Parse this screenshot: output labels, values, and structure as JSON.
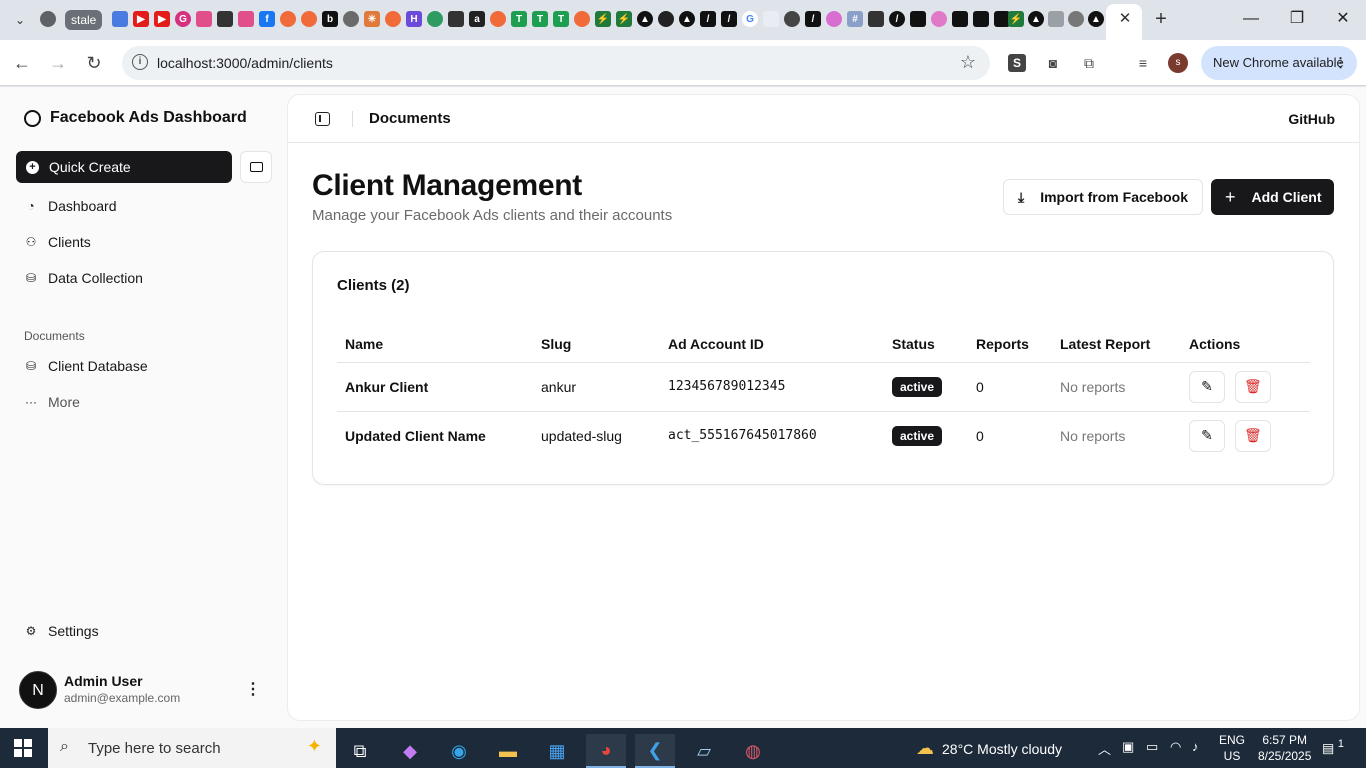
{
  "browser": {
    "stale_label": "stale",
    "url": "localhost:3000/admin/clients",
    "profile_initial": "s",
    "new_chrome_label": "New Chrome available"
  },
  "sidebar": {
    "brand": "Facebook Ads Dashboard",
    "quick_create": "Quick Create",
    "nav": [
      {
        "label": "Dashboard",
        "icon": "gauge-icon"
      },
      {
        "label": "Clients",
        "icon": "users-icon"
      },
      {
        "label": "Data Collection",
        "icon": "database-icon"
      }
    ],
    "documents_label": "Documents",
    "documents": [
      {
        "label": "Client Database",
        "icon": "database-icon"
      },
      {
        "label": "More",
        "icon": "ellipsis-icon"
      }
    ],
    "settings": "Settings",
    "user": {
      "initial": "N",
      "name": "Admin User",
      "email": "admin@example.com"
    }
  },
  "header": {
    "title": "Documents",
    "github": "GitHub"
  },
  "page": {
    "title": "Client Management",
    "subtitle": "Manage your Facebook Ads clients and their accounts",
    "import_label": "Import from Facebook",
    "add_label": "Add Client"
  },
  "clients_card": {
    "title": "Clients (2)",
    "columns": [
      "Name",
      "Slug",
      "Ad Account ID",
      "Status",
      "Reports",
      "Latest Report",
      "Actions"
    ],
    "rows": [
      {
        "name": "Ankur Client",
        "slug": "ankur",
        "ad_account": "123456789012345",
        "status": "active",
        "reports": "0",
        "latest": "No reports"
      },
      {
        "name": "Updated Client Name",
        "slug": "updated-slug",
        "ad_account": "act_555167645017860",
        "status": "active",
        "reports": "0",
        "latest": "No reports"
      }
    ]
  },
  "taskbar": {
    "search_placeholder": "Type here to search",
    "weather": "28°C  Mostly cloudy",
    "lang_top": "ENG",
    "lang_bottom": "US",
    "time": "6:57 PM",
    "date": "8/25/2025",
    "notification_count": "1"
  }
}
